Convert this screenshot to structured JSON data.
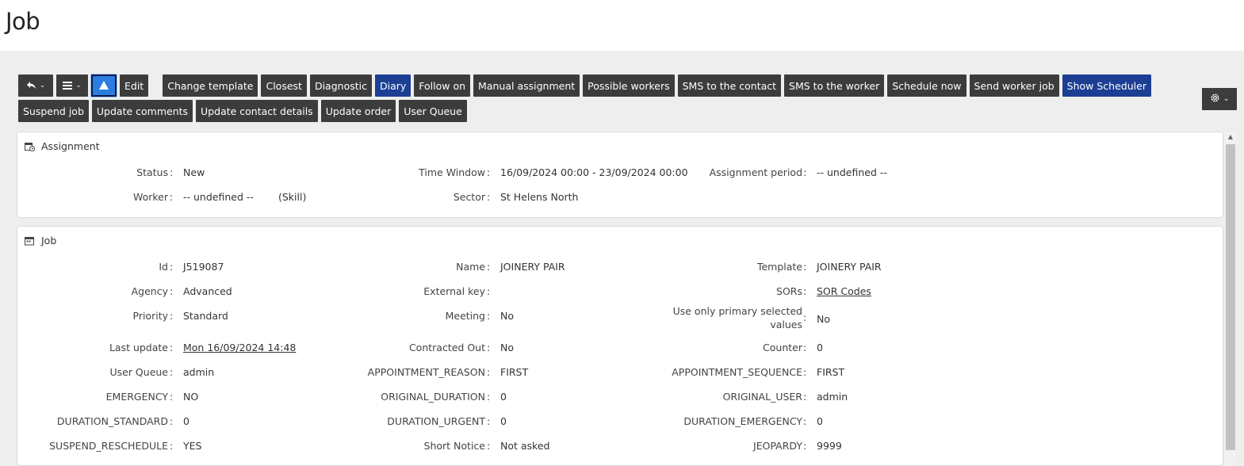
{
  "page": {
    "title": "Job"
  },
  "toolbar": {
    "edit": "Edit",
    "buttons": [
      "Change template",
      "Closest",
      "Diagnostic",
      "Diary",
      "Follow on",
      "Manual assignment",
      "Possible workers",
      "SMS to the contact",
      "SMS to the worker",
      "Schedule now",
      "Send worker job",
      "Show Scheduler",
      "Suspend job",
      "Update comments",
      "Update contact details",
      "Update order",
      "User Queue"
    ],
    "primary_buttons": [
      "Diary",
      "Show Scheduler"
    ],
    "accent_color": "#1c3f94",
    "button_color": "#3c3c3c"
  },
  "assignment": {
    "title": "Assignment",
    "status": {
      "label": "Status",
      "value": "New"
    },
    "time_window": {
      "label": "Time Window",
      "value": "16/09/2024 00:00 - 23/09/2024 00:00"
    },
    "assignment_period": {
      "label": "Assignment period",
      "value": "-- undefined --"
    },
    "worker": {
      "label": "Worker",
      "value": "-- undefined --",
      "skill": "(Skill)"
    },
    "sector": {
      "label": "Sector",
      "value": "St Helens North"
    }
  },
  "job": {
    "title": "Job",
    "id": {
      "label": "Id",
      "value": "J519087"
    },
    "name": {
      "label": "Name",
      "value": "JOINERY PAIR"
    },
    "template": {
      "label": "Template",
      "value": "JOINERY PAIR"
    },
    "agency": {
      "label": "Agency",
      "value": "Advanced"
    },
    "external_key": {
      "label": "External key",
      "value": ""
    },
    "sors": {
      "label": "SORs",
      "value": "SOR Codes"
    },
    "priority": {
      "label": "Priority",
      "value": "Standard"
    },
    "meeting": {
      "label": "Meeting",
      "value": "No"
    },
    "primary_values": {
      "label": "Use only primary selected values",
      "value": "No"
    },
    "last_update": {
      "label": "Last update",
      "value": "Mon 16/09/2024 14:48"
    },
    "contracted_out": {
      "label": "Contracted Out",
      "value": "No"
    },
    "counter": {
      "label": "Counter",
      "value": "0"
    },
    "user_queue": {
      "label": "User Queue",
      "value": "admin"
    },
    "appointment_reason": {
      "label": "APPOINTMENT_REASON",
      "value": "FIRST"
    },
    "appointment_sequence": {
      "label": "APPOINTMENT_SEQUENCE",
      "value": "FIRST"
    },
    "emergency": {
      "label": "EMERGENCY",
      "value": "NO"
    },
    "original_duration": {
      "label": "ORIGINAL_DURATION",
      "value": "0"
    },
    "original_user": {
      "label": "ORIGINAL_USER",
      "value": "admin"
    },
    "duration_standard": {
      "label": "DURATION_STANDARD",
      "value": "0"
    },
    "duration_urgent": {
      "label": "DURATION_URGENT",
      "value": "0"
    },
    "duration_emergency": {
      "label": "DURATION_EMERGENCY",
      "value": "0"
    },
    "suspend_reschedule": {
      "label": "SUSPEND_RESCHEDULE",
      "value": "YES"
    },
    "short_notice": {
      "label": "Short Notice",
      "value": "Not asked"
    },
    "jeopardy": {
      "label": "JEOPARDY",
      "value": "9999"
    }
  },
  "colon": ":",
  "icons": {
    "back": "reply-icon",
    "menu": "list-icon",
    "selected": "triangle-up-icon",
    "settings": "gear-icon",
    "assignment": "calendar-clock-icon",
    "job": "calendar-icon"
  }
}
